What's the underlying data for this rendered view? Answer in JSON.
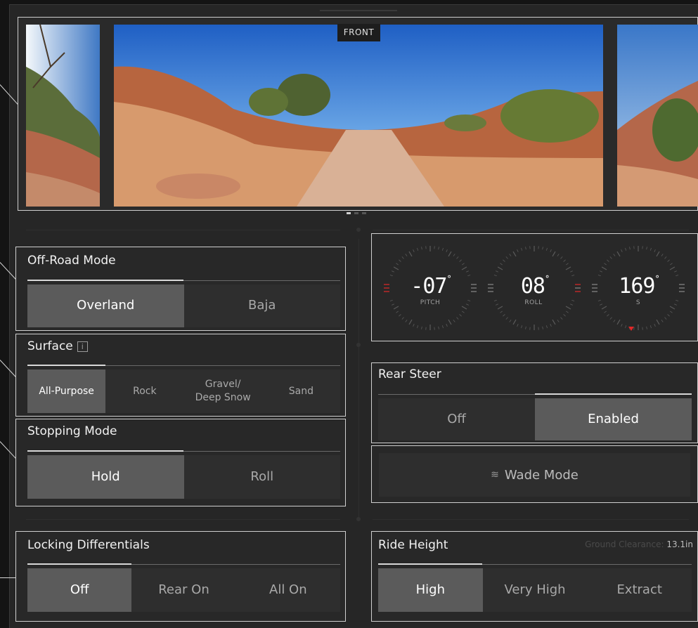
{
  "camera": {
    "label": "FRONT",
    "views": [
      "left-camera",
      "front-camera",
      "right-camera"
    ],
    "active_view_index": 0
  },
  "offroad_mode": {
    "title": "Off-Road Mode",
    "options": [
      "Overland",
      "Baja"
    ],
    "selected": "Overland"
  },
  "surface": {
    "title": "Surface",
    "info_icon": "i",
    "options": [
      "All-Purpose",
      "Rock",
      "Gravel/\nDeep Snow",
      "Sand"
    ],
    "selected": "All-Purpose"
  },
  "stopping_mode": {
    "title": "Stopping Mode",
    "options": [
      "Hold",
      "Roll"
    ],
    "selected": "Hold"
  },
  "locking_differentials": {
    "title": "Locking Differentials",
    "options": [
      "Off",
      "Rear On",
      "All On"
    ],
    "selected": "Off"
  },
  "gauges": {
    "pitch": {
      "value": "-07",
      "unit": "°",
      "label": "PITCH"
    },
    "roll": {
      "value": "08",
      "unit": "°",
      "label": "ROLL"
    },
    "heading": {
      "value": "169",
      "unit": "°",
      "label": "S"
    }
  },
  "rear_steer": {
    "title": "Rear Steer",
    "options": [
      "Off",
      "Enabled"
    ],
    "selected": "Enabled"
  },
  "wade_mode": {
    "label": "Wade Mode",
    "icon": "wave-icon"
  },
  "ride_height": {
    "title": "Ride Height",
    "ground_clearance_label": "Ground Clearance:",
    "ground_clearance_value": "13.1in",
    "options": [
      "High",
      "Very High",
      "Extract"
    ],
    "selected": "High"
  },
  "colors": {
    "background": "#262626",
    "active_segment": "#5b5b5b",
    "inactive_segment": "#2e2e2e",
    "border": "#d0d0d0",
    "indicator_red": "#e02828"
  }
}
